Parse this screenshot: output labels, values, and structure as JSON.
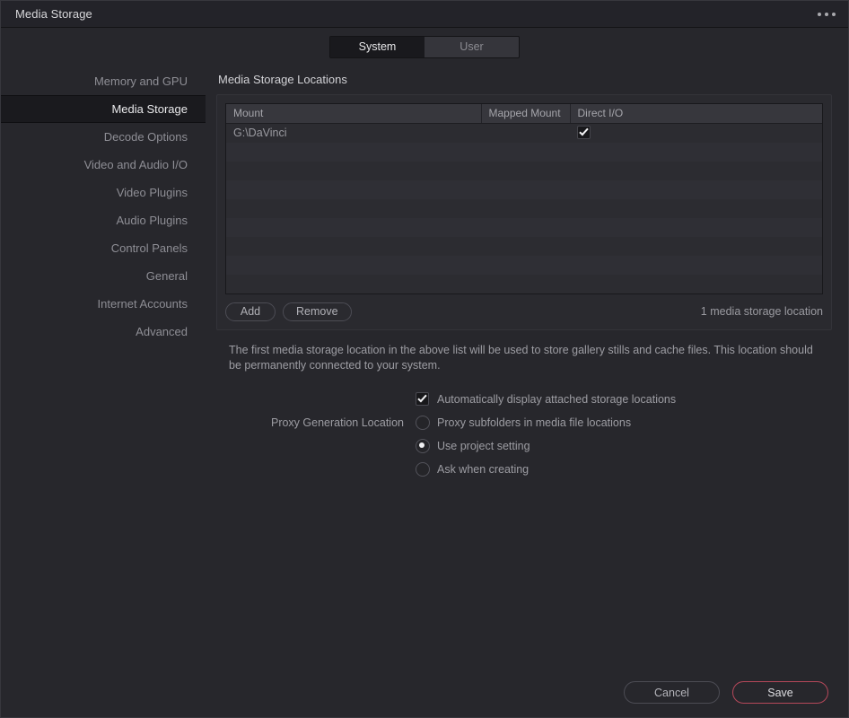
{
  "window": {
    "title": "Media Storage",
    "overflow_menu_icon": "ellipsis-icon"
  },
  "tabs": [
    {
      "label": "System",
      "active": true
    },
    {
      "label": "User",
      "active": false
    }
  ],
  "sidebar": {
    "items": [
      {
        "label": "Memory and GPU",
        "active": false
      },
      {
        "label": "Media Storage",
        "active": true
      },
      {
        "label": "Decode Options",
        "active": false
      },
      {
        "label": "Video and Audio I/O",
        "active": false
      },
      {
        "label": "Video Plugins",
        "active": false
      },
      {
        "label": "Audio Plugins",
        "active": false
      },
      {
        "label": "Control Panels",
        "active": false
      },
      {
        "label": "General",
        "active": false
      },
      {
        "label": "Internet Accounts",
        "active": false
      },
      {
        "label": "Advanced",
        "active": false
      }
    ]
  },
  "main": {
    "section_title": "Media Storage Locations",
    "table": {
      "columns": [
        "Mount",
        "Mapped Mount",
        "Direct I/O"
      ],
      "rows": [
        {
          "mount": "G:\\DaVinci",
          "mapped_mount": "",
          "direct_io": true
        }
      ],
      "empty_row_count": 7
    },
    "buttons": {
      "add_label": "Add",
      "remove_label": "Remove"
    },
    "count_label": "1 media storage location",
    "description": "The first media storage location in the above list will be used to store gallery stills and cache files. This location should be permanently connected to your system.",
    "options": {
      "auto_display": {
        "label": "Automatically display attached storage locations",
        "checked": true
      },
      "proxy_generation_label": "Proxy Generation Location",
      "proxy_choices": [
        {
          "label": "Proxy subfolders in media file locations",
          "selected": false
        },
        {
          "label": "Use project setting",
          "selected": true
        },
        {
          "label": "Ask when creating",
          "selected": false
        }
      ]
    }
  },
  "footer": {
    "cancel_label": "Cancel",
    "save_label": "Save"
  },
  "colors": {
    "background": "#27272c",
    "titlebar": "#232329",
    "accent_save_border": "#b5485a",
    "sidebar_active_bg": "#1a1a1e",
    "table_header_bg": "#37373d"
  }
}
